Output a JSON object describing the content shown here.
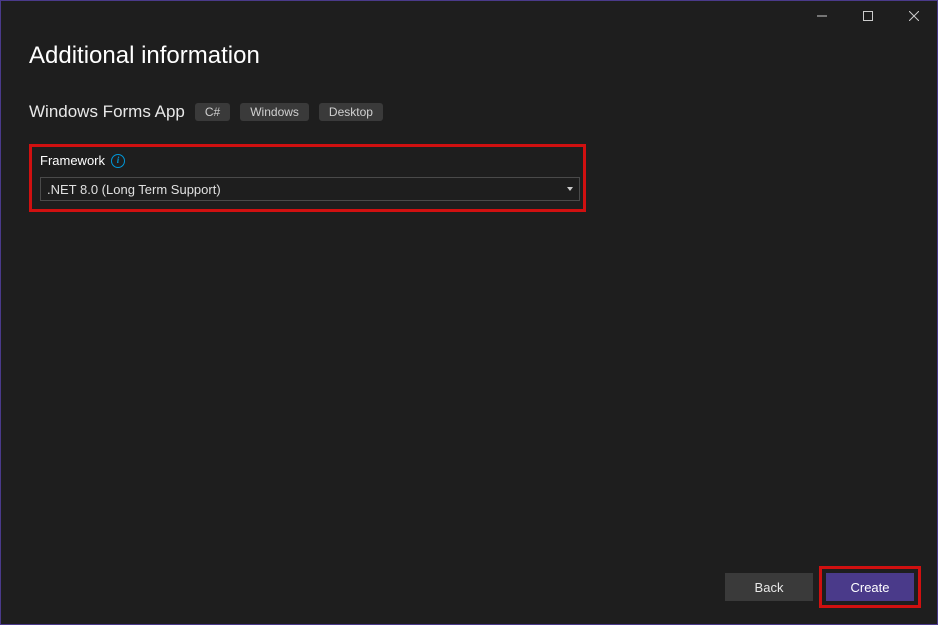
{
  "window_controls": {
    "minimize": "minimize",
    "maximize": "maximize",
    "close": "close"
  },
  "page": {
    "title": "Additional information",
    "subtitle": "Windows Forms App"
  },
  "tags": [
    "C#",
    "Windows",
    "Desktop"
  ],
  "framework": {
    "label": "Framework",
    "info_tooltip": "i",
    "selected": ".NET 8.0 (Long Term Support)"
  },
  "buttons": {
    "back": "Back",
    "create": "Create"
  }
}
